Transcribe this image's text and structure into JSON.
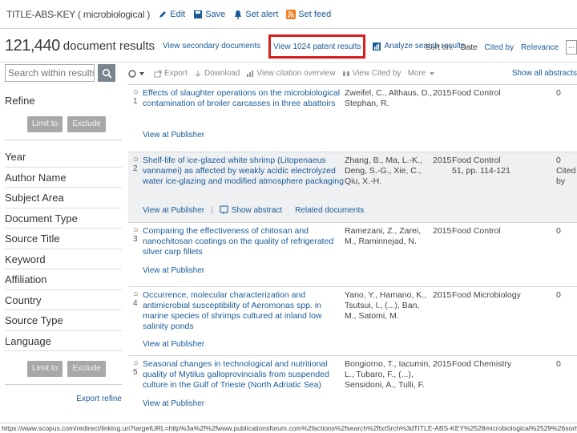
{
  "topbar": {
    "query": "TITLE-ABS-KEY ( microbiological )",
    "actions": [
      {
        "icon": "edit-icon",
        "label": "Edit"
      },
      {
        "icon": "save-icon",
        "label": "Save"
      },
      {
        "icon": "alert-icon",
        "label": "Set alert"
      },
      {
        "icon": "rss-icon",
        "label": "Set feed"
      }
    ]
  },
  "results": {
    "count": "121,440",
    "count_label": "document results",
    "view_secondary": "View secondary documents",
    "view_patents": "View 1024 patent results",
    "analyze": "Analyze search results",
    "sort_label": "Sort on:",
    "sort_options": [
      "Date",
      "Cited by",
      "Relevance"
    ],
    "more": "..."
  },
  "sidebar": {
    "search_placeholder": "Search within results...",
    "refine": "Refine",
    "limit_to": "Limit to",
    "exclude": "Exclude",
    "facets": [
      "Year",
      "Author Name",
      "Subject Area",
      "Document Type",
      "Source Title",
      "Keyword",
      "Affiliation",
      "Country",
      "Source Type",
      "Language"
    ],
    "export_refine": "Export refine"
  },
  "toolbar": {
    "select": "",
    "export": "Export",
    "download": "Download",
    "citation_overview": "View citation overview",
    "view_cited_by": "View Cited by",
    "more": "More",
    "show_all_abstracts": "Show all abstracts"
  },
  "documents": [
    {
      "num": "1",
      "title": "Effects of slaughter operations on the microbiological contamination of broiler carcasses in three abattoirs",
      "authors": "Zweifel, C., Althaus, D., Stephan, R.",
      "year": "2015",
      "source": "Food Control",
      "cited": "0",
      "links": [
        "View at Publisher"
      ]
    },
    {
      "num": "2",
      "title": "Shelf-life of ice-glazed white shrimp (Litopenaeus vannamei) as affected by weakly acidic electrolyzed water ice-glazing and modified atmosphere packaging",
      "authors": "Zhang, B., Ma, L.-K., Deng, S.-G., Xie, C., Qiu, X.-H.",
      "year": "2015",
      "source": "Food Control",
      "source_detail": "51, pp. 114-121",
      "cited": "0 Cited by",
      "links": [
        "View at Publisher",
        "Show abstract",
        "Related documents"
      ]
    },
    {
      "num": "3",
      "title": "Comparing the effectiveness of chitosan and nanochitosan coatings on the quality of refrigerated silver carp fillets",
      "authors": "Ramezani, Z., Zarei, M., Raminnejad, N.",
      "year": "2015",
      "source": "Food Control",
      "cited": "0",
      "links": [
        "View at Publisher"
      ]
    },
    {
      "num": "4",
      "title": "Occurrence, molecular characterization and antimicrobial susceptibility of Aeromonas spp. in marine species of shrimps cultured at inland low salinity ponds",
      "authors": "Yano, Y., Hamano, K., Tsutsui, I., (...), Ban, M., Satomi, M.",
      "year": "2015",
      "source": "Food Microbiology",
      "cited": "0",
      "links": [
        "View at Publisher"
      ]
    },
    {
      "num": "5",
      "title": "Seasonal changes in technological and nutritional quality of Mytilus galloprovincialis from suspended culture in the Gulf of Trieste (North Adriatic Sea)",
      "authors": "Bongiorno, T., Iacumin, L., Tubaro, F., (...), Sensidoni, A., Tulli, F.",
      "year": "2015",
      "source": "Food Chemistry",
      "cited": "0",
      "links": [
        "View at Publisher"
      ]
    }
  ],
  "statusbar": {
    "url": "https://www.scopus.com/redirect/linking.uri?targetURL=http%3a%2f%2fwww.publicationsforum.com%2factions%2fsearch%2ftxtSrch%3dTITLE-ABS-KEY%2528microbiological%2529%26sort%3dplf-f%26src%3ds%26sid%3d%26sot%3db%26sdt%3db%26sl%3d30%26s%3dTITLE-ABS-KEY%2528microbiological%2529%26origin%3dsearchbasic%26editSaveSearch%3d%26txGid%3d0"
  },
  "colors": {
    "link": "#1a5a96",
    "highlight_border": "#d81e1e",
    "button_grey": "#a8a8a8",
    "alt_row": "#eef0f2"
  }
}
